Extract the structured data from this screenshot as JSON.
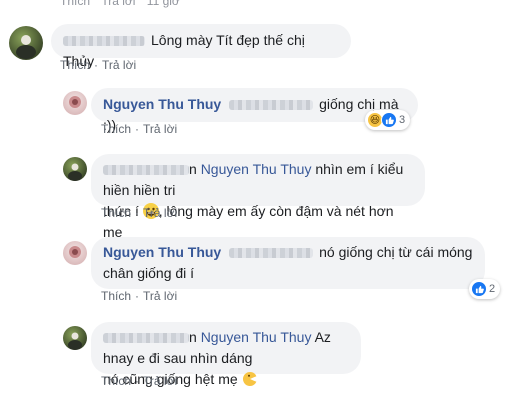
{
  "top_fragment": [
    "Thích",
    "Trả lời",
    "11 giờ"
  ],
  "action_like": "Thích",
  "action_reply": "Trả lời",
  "comments": [
    {
      "text": "Lông mày Tít đẹp thế chị Thủy"
    },
    {
      "author": "Nguyen Thu Thuy",
      "text": "giống chị mà :))",
      "reaction_count": "3"
    },
    {
      "author_suffix": "n",
      "tag": "Nguyen Thu Thuy",
      "text_line1": "nhìn em í kiểu hiền hiền tri",
      "text_line2a": "thức í",
      "text_line2b": ", lông mày em ấy còn đậm và nét hơn mẹ"
    },
    {
      "author": "Nguyen Thu Thuy",
      "text_line1": "nó giống chị từ cái móng",
      "text_line2": "chân giống đi í",
      "reaction_count": "2"
    },
    {
      "author_suffix": "n",
      "tag": "Nguyen Thu Thuy",
      "text_line1": "Az hnay e đi sau nhìn dáng",
      "text_line2": "nó cũng giống hệt mẹ"
    }
  ]
}
